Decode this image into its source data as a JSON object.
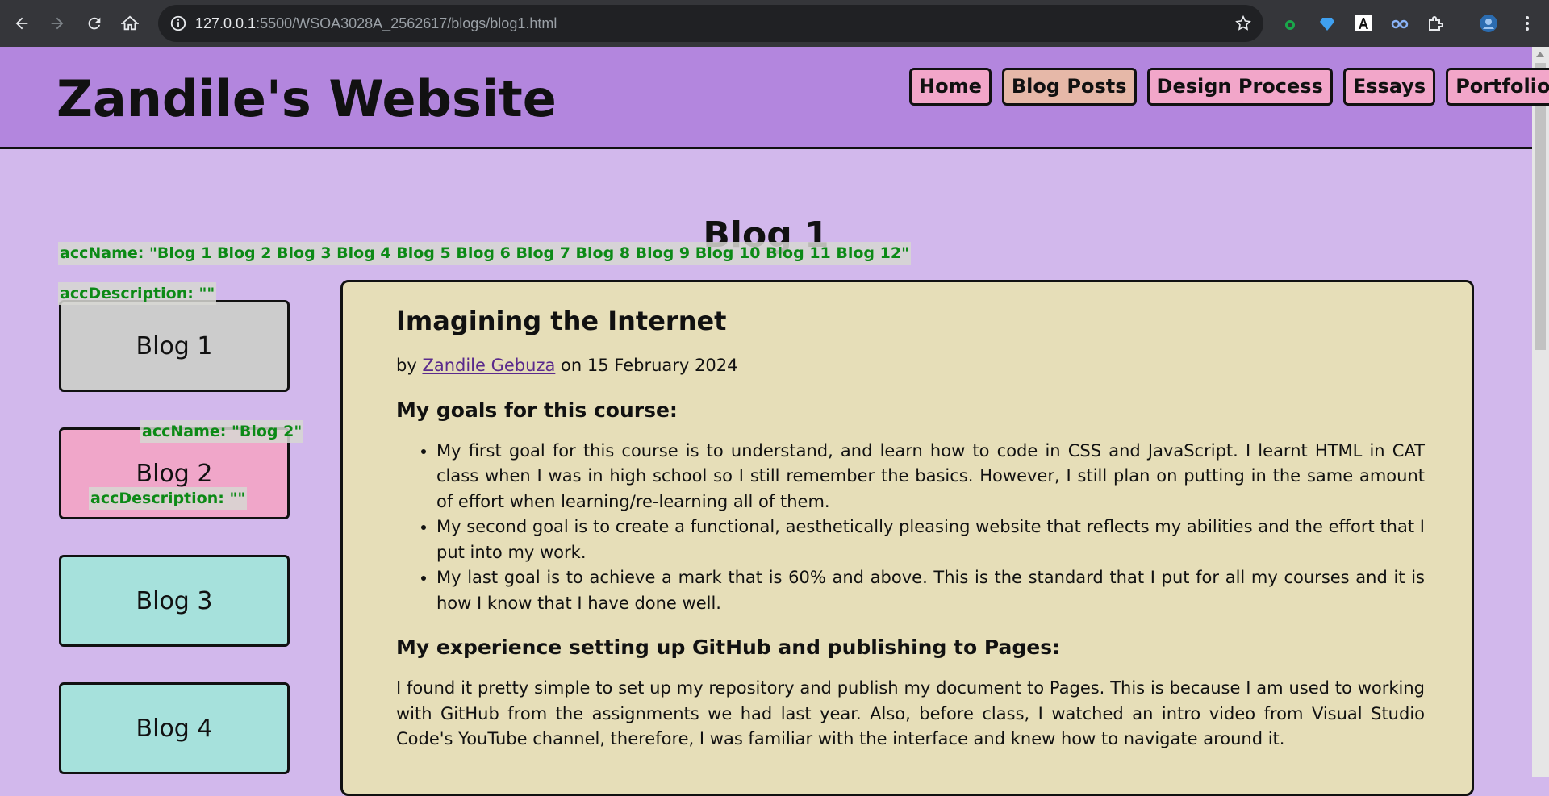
{
  "browser": {
    "url_host": "127.0.0.1",
    "url_path": ":5500/WSOA3028A_2562617/blogs/blog1.html"
  },
  "site": {
    "title": "Zandile's Website",
    "nav": [
      "Home",
      "Blog Posts",
      "Design Process",
      "Essays",
      "Portfolio"
    ],
    "active_nav": "Blog Posts"
  },
  "page": {
    "heading": "Blog 1"
  },
  "accessibility_overlay": {
    "list_name": "accName: \"Blog 1 Blog 2 Blog 3 Blog 4 Blog 5 Blog 6 Blog 7 Blog 8 Blog 9 Blog 10 Blog 11 Blog 12\"",
    "list_description": "accDescription: \"\"",
    "item_name": "accName: \"Blog 2\"",
    "item_description": "accDescription: \"\""
  },
  "sidebar": {
    "items": [
      {
        "label": "Blog 1",
        "color": "#cccccc"
      },
      {
        "label": "Blog 2",
        "color": "#f0a6c9"
      },
      {
        "label": "Blog 3",
        "color": "#a6e1dc"
      },
      {
        "label": "Blog 4",
        "color": "#a6e1dc"
      }
    ]
  },
  "article": {
    "title": "Imagining the Internet",
    "by_prefix": "by",
    "author": "Zandile Gebuza",
    "date_text": "on 15 February 2024",
    "section1_heading": "My goals for this course:",
    "goals": [
      "My first goal for this course is to understand, and learn how to code in CSS and JavaScript. I learnt HTML in CAT class when I was in high school so I still remember the basics. However, I still plan on putting in the same amount of effort when learning/re-learning all of them.",
      "My second goal is to create a functional, aesthetically pleasing website that reflects my abilities and the effort that I put into my work.",
      "My last goal is to achieve a mark that is 60% and above. This is the standard that I put for all my courses and it is how I know that I have done well."
    ],
    "section2_heading": "My experience setting up GitHub and publishing to Pages:",
    "paragraph": "I found it pretty simple to set up my repository and publish my document to Pages. This is because I am used to working with GitHub from the assignments we had last year. Also, before class, I watched an intro video from Visual Studio Code's YouTube channel, therefore, I was familiar with the interface and knew how to navigate around it."
  },
  "colors": {
    "header_bg": "#b386de",
    "page_bg": "#d2b8ec",
    "nav_button": "#f2a6c9",
    "nav_active": "#e6b8a8",
    "article_bg": "#e6deb8"
  }
}
